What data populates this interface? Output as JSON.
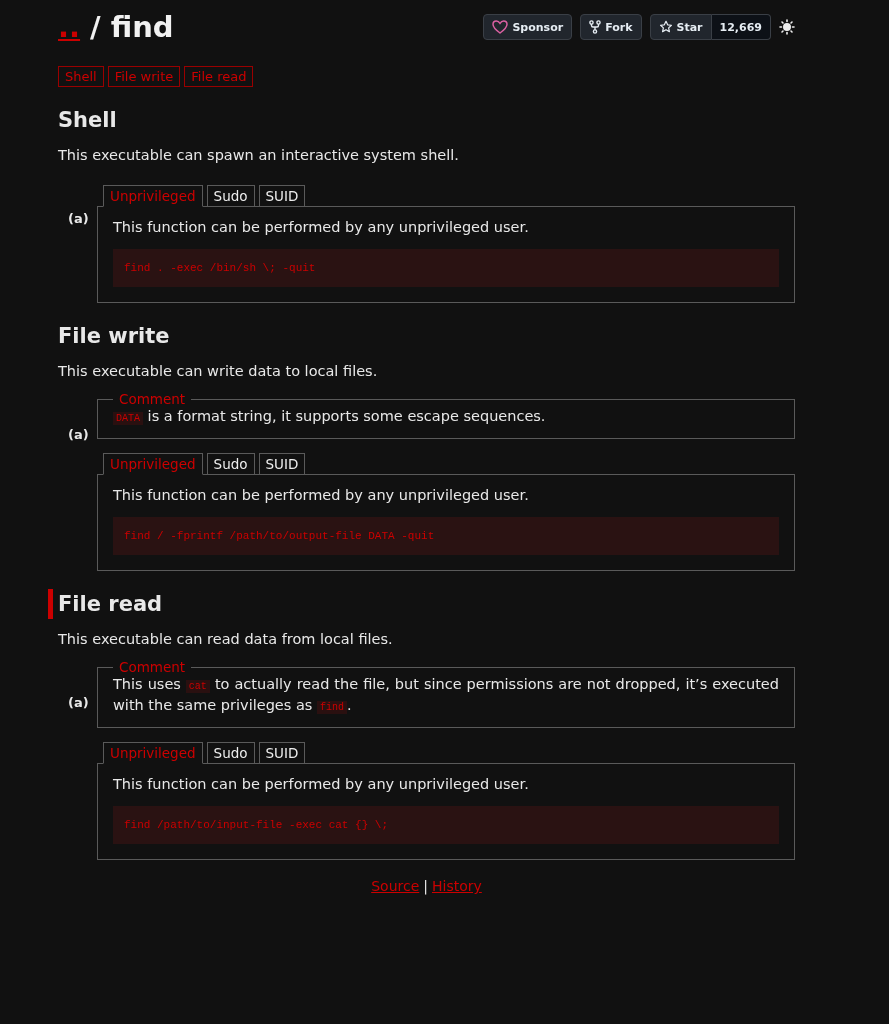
{
  "header": {
    "parent_link": "..",
    "separator": "/",
    "title": "find"
  },
  "actions": [
    {
      "kind": "sponsor",
      "label": "Sponsor"
    },
    {
      "kind": "fork",
      "label": "Fork"
    },
    {
      "kind": "star",
      "label": "Star",
      "count": "12,669"
    }
  ],
  "tags": [
    "Shell",
    "File write",
    "File read"
  ],
  "sections": [
    {
      "title": "Shell",
      "targeted": false,
      "description": "This executable can spawn an interactive system shell.",
      "examples": [
        {
          "label": "(a)",
          "tabs": [
            {
              "label": "Unprivileged",
              "selected": true
            },
            {
              "label": "Sudo",
              "selected": false
            },
            {
              "label": "SUID",
              "selected": false
            }
          ],
          "body": "This function can be performed by any unprivileged user.",
          "code": "find . -exec /bin/sh \\; -quit"
        }
      ]
    },
    {
      "title": "File write",
      "targeted": false,
      "description": "This executable can write data to local files.",
      "examples": [
        {
          "label": "(a)",
          "comment": {
            "legend": "Comment",
            "parts": [
              {
                "kind": "code",
                "text": "DATA"
              },
              {
                "kind": "text",
                "text": " is a format string, it supports some escape sequences."
              }
            ]
          },
          "tabs": [
            {
              "label": "Unprivileged",
              "selected": true
            },
            {
              "label": "Sudo",
              "selected": false
            },
            {
              "label": "SUID",
              "selected": false
            }
          ],
          "body": "This function can be performed by any unprivileged user.",
          "code": "find / -fprintf /path/to/output-file DATA -quit"
        }
      ]
    },
    {
      "title": "File read",
      "targeted": true,
      "description": "This executable can read data from local files.",
      "examples": [
        {
          "label": "(a)",
          "comment": {
            "legend": "Comment",
            "parts": [
              {
                "kind": "text",
                "text": "This uses "
              },
              {
                "kind": "code",
                "text": "cat"
              },
              {
                "kind": "text",
                "text": " to actually read the file, but since permissions are not dropped, it’s executed with the same privileges as "
              },
              {
                "kind": "code",
                "text": "find"
              },
              {
                "kind": "text",
                "text": "."
              }
            ]
          },
          "tabs": [
            {
              "label": "Unprivileged",
              "selected": true
            },
            {
              "label": "Sudo",
              "selected": false
            },
            {
              "label": "SUID",
              "selected": false
            }
          ],
          "body": "This function can be performed by any unprivileged user.",
          "code": "find /path/to/input-file -exec cat {} \\;"
        }
      ]
    }
  ],
  "footer": {
    "links": [
      "Source",
      "History"
    ],
    "separator": "|"
  }
}
